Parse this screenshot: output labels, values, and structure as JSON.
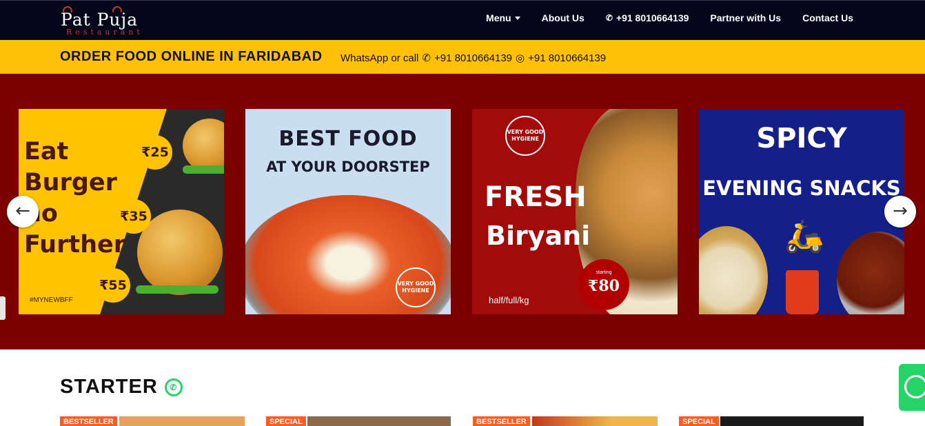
{
  "brand": {
    "name": "Pat Puja",
    "tagline": "Restaurant"
  },
  "nav": {
    "items": [
      {
        "label": "Menu",
        "has_dropdown": true
      },
      {
        "label": "About Us"
      },
      {
        "label": "+91 8010664139",
        "icon": "phone-icon"
      },
      {
        "label": "Partner with Us"
      },
      {
        "label": "Contact Us"
      }
    ]
  },
  "strip": {
    "title": "ORDER FOOD ONLINE IN FARIDABAD",
    "contact_prefix": "WhatsApp or call",
    "phone": "+91 8010664139",
    "whatsapp": "+91 8010664139"
  },
  "carousel": {
    "slides": [
      {
        "lines": [
          "Eat",
          "Burger",
          "no",
          "Further"
        ],
        "prices": [
          "₹25",
          "₹35",
          "₹55"
        ],
        "hashtag": "#MYNEWBFF"
      },
      {
        "title": "BEST FOOD",
        "subtitle": "AT YOUR DOORSTEP",
        "badge": "VERY GOOD HYGIENE"
      },
      {
        "badge": "VERY GOOD HYGIENE",
        "title": "FRESH",
        "subtitle": "Biryani",
        "price_label": "starting",
        "price": "₹80",
        "note": "half/full/kg"
      },
      {
        "title": "SPICY",
        "subtitle": "EVENING SNACKS"
      }
    ],
    "prev_icon": "arrow-left-icon",
    "next_icon": "arrow-right-icon"
  },
  "section": {
    "title": "STARTER",
    "icon": "whatsapp-icon",
    "cards": [
      {
        "tag": "BESTSELLER"
      },
      {
        "tag": "SPECIAL"
      },
      {
        "tag": "BESTSELLER"
      },
      {
        "tag": "SPECIAL"
      }
    ]
  },
  "colors": {
    "navbar": "#06061a",
    "strip": "#ffc107",
    "carousel_bg": "#7d0000",
    "tag": "#ff5a1f",
    "whatsapp": "#25d366"
  }
}
